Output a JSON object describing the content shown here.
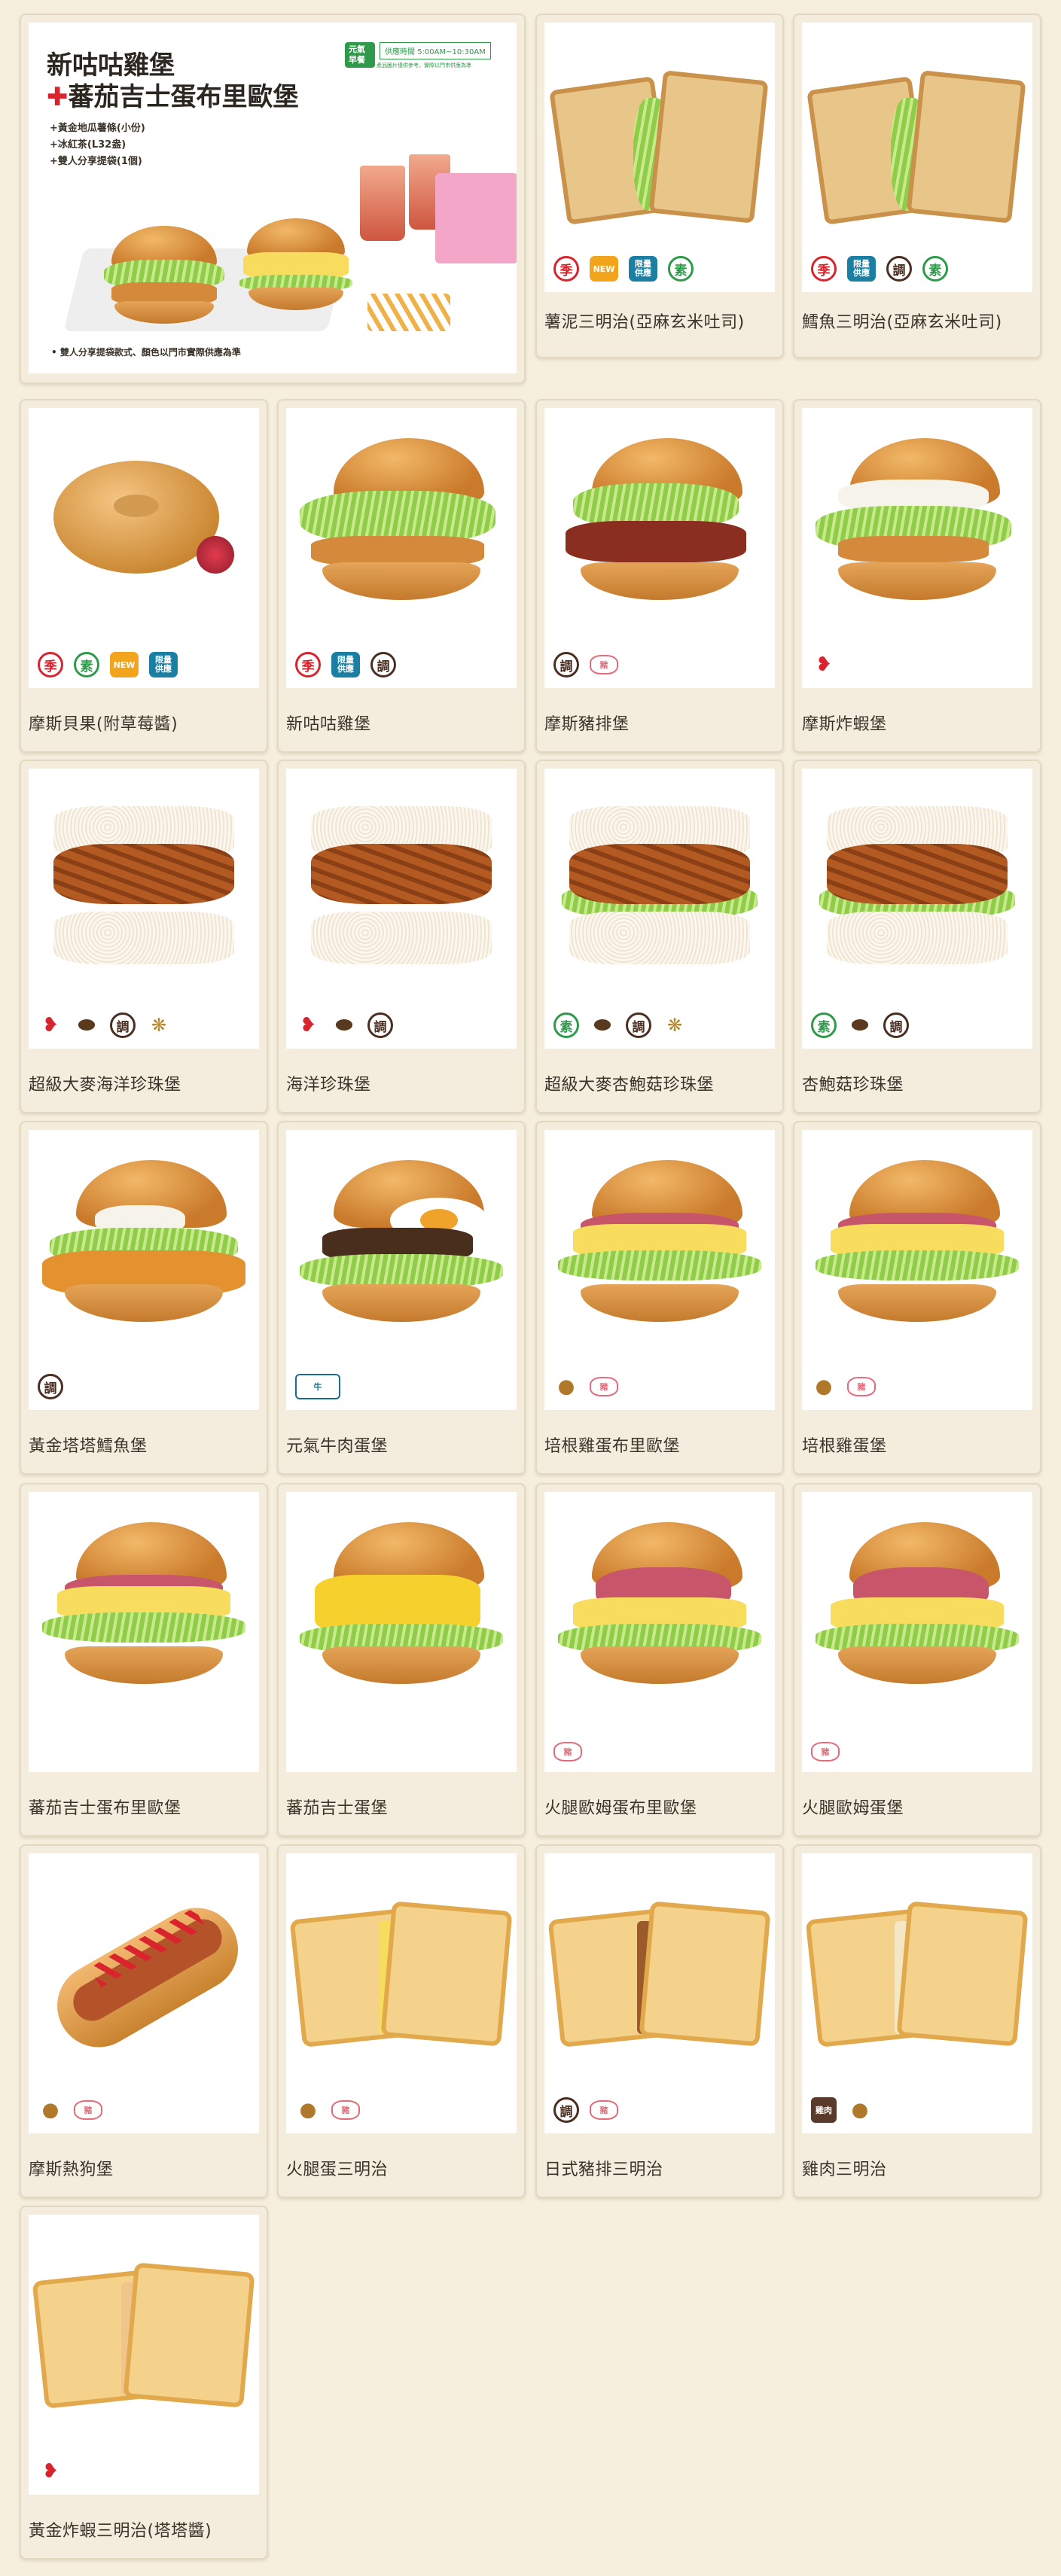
{
  "promo": {
    "badge": "元氣早餐",
    "time_label": "供應時間",
    "time_range": "5:00AM~10:30AM",
    "note": "產品圖片僅供參考，實際以門市供應為準",
    "title_line1": "新咕咕雞堡",
    "title_line2_plus": "✚",
    "title_line2": "蕃茄吉士蛋布里歐堡",
    "lines": [
      "+黃金地瓜薯條(小份)",
      "+冰紅茶(L32盎)",
      "+雙人分享提袋(1個)"
    ],
    "footnote": "• 雙人分享提袋款式、顏色以門市實際供應為準"
  },
  "items": [
    {
      "name": "薯泥三明治(亞麻玄米吐司)",
      "icons": [
        "季",
        "NEW",
        "限量供應",
        "素"
      ]
    },
    {
      "name": "鱈魚三明治(亞麻玄米吐司)",
      "icons": [
        "季",
        "限量供應",
        "調",
        "素"
      ]
    },
    {
      "name": "摩斯貝果(附草莓醬)",
      "icons": [
        "季",
        "素",
        "NEW",
        "限量供應"
      ]
    },
    {
      "name": "新咕咕雞堡",
      "icons": [
        "季",
        "限量供應",
        "調"
      ]
    },
    {
      "name": "摩斯豬排堡",
      "icons": [
        "調",
        "豬"
      ]
    },
    {
      "name": "摩斯炸蝦堡",
      "icons": [
        "蝦"
      ]
    },
    {
      "name": "超級大麥海洋珍珠堡",
      "icons": [
        "蝦",
        "堅果",
        "調",
        "麥"
      ]
    },
    {
      "name": "海洋珍珠堡",
      "icons": [
        "蝦",
        "堅果",
        "調"
      ]
    },
    {
      "name": "超級大麥杏鮑菇珍珠堡",
      "icons": [
        "素",
        "堅果",
        "調",
        "麥"
      ]
    },
    {
      "name": "杏鮑菇珍珠堡",
      "icons": [
        "素",
        "堅果",
        "調"
      ]
    },
    {
      "name": "黃金塔塔鱈魚堡",
      "icons": [
        "調"
      ]
    },
    {
      "name": "元氣牛肉蛋堡",
      "icons": [
        "非美牛"
      ]
    },
    {
      "name": "培根雞蛋布里歐堡",
      "icons": [
        "花生",
        "豬"
      ]
    },
    {
      "name": "培根雞蛋堡",
      "icons": [
        "花生",
        "豬"
      ]
    },
    {
      "name": "蕃茄吉士蛋布里歐堡",
      "icons": []
    },
    {
      "name": "蕃茄吉士蛋堡",
      "icons": []
    },
    {
      "name": "火腿歐姆蛋布里歐堡",
      "icons": [
        "豬"
      ]
    },
    {
      "name": "火腿歐姆蛋堡",
      "icons": [
        "豬"
      ]
    },
    {
      "name": "摩斯熱狗堡",
      "icons": [
        "花生",
        "豬"
      ]
    },
    {
      "name": "火腿蛋三明治",
      "icons": [
        "花生",
        "豬"
      ]
    },
    {
      "name": "日式豬排三明治",
      "icons": [
        "調",
        "豬"
      ]
    },
    {
      "name": "雞肉三明治",
      "icons": [
        "雞肉供應",
        "花生"
      ]
    },
    {
      "name": "黃金炸蝦三明治(塔塔醬)",
      "icons": [
        "蝦"
      ]
    }
  ],
  "colors": {
    "page_bg": "#f6efde",
    "card_bg": "#f4ecdc",
    "label_text": "#3a332a",
    "seasonal_red": "#d9232d",
    "veg_green": "#2e9a4a",
    "limited_blue": "#1a7fa3",
    "new_orange": "#f2a51c"
  }
}
